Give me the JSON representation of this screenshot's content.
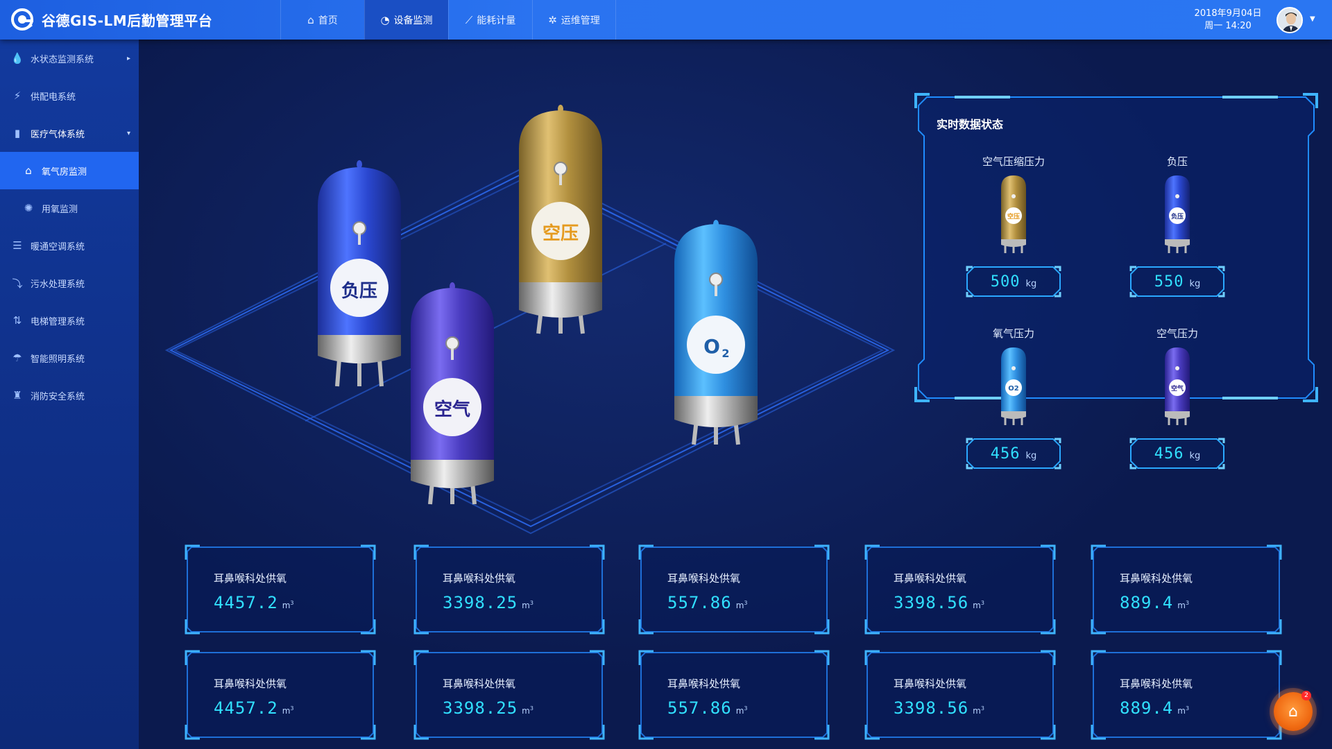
{
  "header": {
    "title": "谷德GIS-LM后勤管理平台",
    "date": "2018年9月04日",
    "weekday_time": "周一 14:20",
    "nav": [
      {
        "label": "首页",
        "icon": "home-icon"
      },
      {
        "label": "设备监测",
        "icon": "dashboard-icon",
        "active": true
      },
      {
        "label": "能耗计量",
        "icon": "chart-icon"
      },
      {
        "label": "运维管理",
        "icon": "gear-icon"
      }
    ]
  },
  "sidebar": {
    "items": [
      {
        "label": "水状态监测系统",
        "icon": "water-drop-icon",
        "caret": "▸"
      },
      {
        "label": "供配电系统",
        "icon": "power-icon"
      },
      {
        "label": "医疗气体系统",
        "icon": "gas-cylinder-icon",
        "caret": "▾"
      },
      {
        "label": "氧气房监测",
        "icon": "oxygen-icon",
        "active": true
      },
      {
        "label": "用氧监测",
        "icon": "fan-icon"
      },
      {
        "label": "暖通空调系统",
        "icon": "hvac-icon"
      },
      {
        "label": "污水处理系统",
        "icon": "sewage-icon"
      },
      {
        "label": "电梯管理系统",
        "icon": "elevator-icon"
      },
      {
        "label": "智能照明系统",
        "icon": "lamp-icon"
      },
      {
        "label": "消防安全系统",
        "icon": "fire-extinguisher-icon"
      }
    ]
  },
  "scene": {
    "tanks": [
      {
        "label": "负压",
        "color": "#2747c8"
      },
      {
        "label": "空压",
        "color": "#b8973f"
      },
      {
        "label": "空气",
        "color": "#4a3cc0"
      },
      {
        "label": "O",
        "sub": "2",
        "color": "#2f8fe0"
      }
    ]
  },
  "realtime": {
    "title": "实时数据状态",
    "gauges": [
      {
        "label": "空气压缩压力",
        "value": "500",
        "unit": "kg",
        "tank": "空压",
        "color": "#b8973f"
      },
      {
        "label": "负压",
        "value": "550",
        "unit": "kg",
        "tank": "负压",
        "color": "#2747c8"
      },
      {
        "label": "氧气压力",
        "value": "456",
        "unit": "kg",
        "tank": "O2",
        "color": "#2f8fe0"
      },
      {
        "label": "空气压力",
        "value": "456",
        "unit": "kg",
        "tank": "空气",
        "color": "#4a3cc0"
      }
    ]
  },
  "cards": [
    {
      "label": "耳鼻喉科处供氧",
      "value": "4457.2",
      "unit": "m",
      "sup": "3"
    },
    {
      "label": "耳鼻喉科处供氧",
      "value": "3398.25",
      "unit": "m",
      "sup": "3"
    },
    {
      "label": "耳鼻喉科处供氧",
      "value": "557.86",
      "unit": "m",
      "sup": "3"
    },
    {
      "label": "耳鼻喉科处供氧",
      "value": "3398.56",
      "unit": "m",
      "sup": "3"
    },
    {
      "label": "耳鼻喉科处供氧",
      "value": "889.4",
      "unit": "m",
      "sup": "3"
    },
    {
      "label": "耳鼻喉科处供氧",
      "value": "4457.2",
      "unit": "m",
      "sup": "3"
    },
    {
      "label": "耳鼻喉科处供氧",
      "value": "3398.25",
      "unit": "m",
      "sup": "3"
    },
    {
      "label": "耳鼻喉科处供氧",
      "value": "557.86",
      "unit": "m",
      "sup": "3"
    },
    {
      "label": "耳鼻喉科处供氧",
      "value": "3398.56",
      "unit": "m",
      "sup": "3"
    },
    {
      "label": "耳鼻喉科处供氧",
      "value": "889.4",
      "unit": "m",
      "sup": "3"
    }
  ],
  "float_button": {
    "badge": "2",
    "icon": "alarm-icon"
  }
}
